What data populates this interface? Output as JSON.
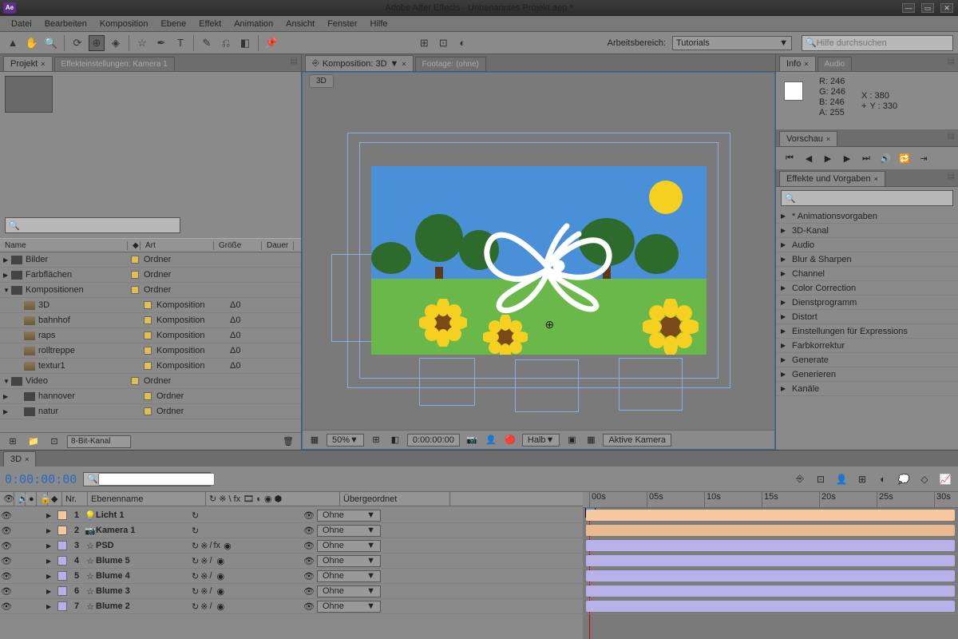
{
  "title": "Adobe After Effects - Unbenanntes Projekt.aep *",
  "logo": "Ae",
  "menu": [
    "Datei",
    "Bearbeiten",
    "Komposition",
    "Ebene",
    "Effekt",
    "Animation",
    "Ansicht",
    "Fenster",
    "Hilfe"
  ],
  "workspace": {
    "label": "Arbeitsbereich:",
    "value": "Tutorials"
  },
  "helpSearch": {
    "placeholder": "Hilfe durchsuchen"
  },
  "project": {
    "tab1": "Projekt",
    "tab2": "Effekteinstellungen: Kamera 1",
    "cols": {
      "name": "Name",
      "type": "Art",
      "size": "Größe",
      "dur": "Dauer"
    },
    "items": [
      {
        "tw": "▶",
        "icon": "folder",
        "name": "Bilder",
        "type": "Ordner",
        "dur": ""
      },
      {
        "tw": "▶",
        "icon": "folder",
        "name": "Farbflächen",
        "type": "Ordner",
        "dur": ""
      },
      {
        "tw": "▼",
        "icon": "folder",
        "name": "Kompositionen",
        "type": "Ordner",
        "dur": ""
      },
      {
        "tw": "",
        "icon": "comp",
        "name": "3D",
        "type": "Komposition",
        "dur": "Δ0",
        "indent": true
      },
      {
        "tw": "",
        "icon": "comp",
        "name": "bahnhof",
        "type": "Komposition",
        "dur": "Δ0",
        "indent": true
      },
      {
        "tw": "",
        "icon": "comp",
        "name": "raps",
        "type": "Komposition",
        "dur": "Δ0",
        "indent": true
      },
      {
        "tw": "",
        "icon": "comp",
        "name": "rolltreppe",
        "type": "Komposition",
        "dur": "Δ0",
        "indent": true
      },
      {
        "tw": "",
        "icon": "comp",
        "name": "textur1",
        "type": "Komposition",
        "dur": "Δ0",
        "indent": true
      },
      {
        "tw": "▼",
        "icon": "folder",
        "name": "Video",
        "type": "Ordner",
        "dur": ""
      },
      {
        "tw": "▶",
        "icon": "folder",
        "name": "hannover",
        "type": "Ordner",
        "dur": "",
        "indent": true
      },
      {
        "tw": "▶",
        "icon": "folder",
        "name": "natur",
        "type": "Ordner",
        "dur": "",
        "indent": true
      }
    ],
    "bits": "8-Bit-Kanal"
  },
  "comp": {
    "tab1": "Komposition: 3D",
    "tab2": "Footage: (ohne)",
    "crumb": "3D",
    "zoom": "50%",
    "time": "0:00:00:00",
    "res": "Halb",
    "view": "Aktive Kamera"
  },
  "info": {
    "tab1": "Info",
    "tab2": "Audio",
    "r": "R:  246",
    "g": "G:  246",
    "b": "B:  246",
    "a": "A:  255",
    "x": "X : 380",
    "y": "Y : 330"
  },
  "preview": {
    "tab": "Vorschau"
  },
  "effects": {
    "tab": "Effekte und Vorgaben",
    "items": [
      "* Animationsvorgaben",
      "3D-Kanal",
      "Audio",
      "Blur & Sharpen",
      "Channel",
      "Color Correction",
      "Dienstprogramm",
      "Distort",
      "Einstellungen für Expressions",
      "Farbkorrektur",
      "Generate",
      "Generieren",
      "Kanäle"
    ]
  },
  "timeline": {
    "tab": "3D",
    "timecode": "0:00:00:00",
    "cols": {
      "nr": "Nr.",
      "name": "Ebenenname",
      "parent": "Übergeordnet"
    },
    "ruler": [
      "00s",
      "05s",
      "10s",
      "15s",
      "20s",
      "25s",
      "30s"
    ],
    "layers": [
      {
        "n": "1",
        "icon": "💡",
        "name": "Licht 1",
        "color": "#f5c8a0",
        "switches": [
          "↻"
        ],
        "parent": "Ohne",
        "barColor": "#f5c8a0"
      },
      {
        "n": "2",
        "icon": "📷",
        "name": "Kamera 1",
        "color": "#f5c8a0",
        "switches": [
          "↻"
        ],
        "parent": "Ohne",
        "barColor": "#e8b890"
      },
      {
        "n": "3",
        "icon": "☆",
        "name": "PSD",
        "color": "#b8b0e8",
        "switches": [
          "↻",
          "※",
          "/",
          "fx",
          "",
          "◉"
        ],
        "parent": "Ohne",
        "barColor": "#b8b0e8"
      },
      {
        "n": "4",
        "icon": "☆",
        "name": "Blume 5",
        "color": "#b8b0e8",
        "switches": [
          "↻",
          "※",
          "/",
          "",
          "",
          "◉"
        ],
        "parent": "Ohne",
        "barColor": "#b8b0e8"
      },
      {
        "n": "5",
        "icon": "☆",
        "name": "Blume 4",
        "color": "#b8b0e8",
        "switches": [
          "↻",
          "※",
          "/",
          "",
          "",
          "◉"
        ],
        "parent": "Ohne",
        "barColor": "#b8b0e8"
      },
      {
        "n": "6",
        "icon": "☆",
        "name": "Blume 3",
        "color": "#b8b0e8",
        "switches": [
          "↻",
          "※",
          "/",
          "",
          "",
          "◉"
        ],
        "parent": "Ohne",
        "barColor": "#b8b0e8"
      },
      {
        "n": "7",
        "icon": "☆",
        "name": "Blume 2",
        "color": "#b8b0e8",
        "switches": [
          "↻",
          "※",
          "/",
          "",
          "",
          "◉"
        ],
        "parent": "Ohne",
        "barColor": "#b8b0e8"
      }
    ]
  }
}
